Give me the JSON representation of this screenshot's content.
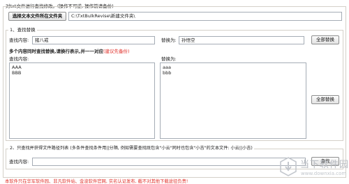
{
  "header": {
    "title": "对txt文件进行查找修改。",
    "note": "(操作不可逆, 操作前请备份)"
  },
  "folder": {
    "button_label": "选择文本文件所在文件夹",
    "path_value": "C:\\TxtBulkRevise\\新建文件夹\\"
  },
  "section1": {
    "legend": "1、查找替换",
    "find_label": "查找内容:",
    "find_value": "猪八戒",
    "replace_label": "替换为:",
    "replace_value": "孙悟空",
    "replace_all_label": "全部替换",
    "multi_title": "多个内容同时查找替换,请换行表示,并一一对应",
    "multi_hint": "(建议先备份)",
    "multi_find_label": "查找内容:",
    "multi_find_lines": "AAA\nBBB",
    "multi_replace_label": "替换为:",
    "multi_replace_lines": "aaa\nbbb",
    "multi_replace_all_label": "全部替换"
  },
  "section2": {
    "legend": "2、只查找并获得文件路径列表 (多条件查找条件用||分隔, 例如需要查找既包含\"小云\"同时也包含\"小吉\"的文本文件: 小云||小吉)",
    "find_label": "查找内容:",
    "find_value": "",
    "find_button_label": "查找"
  },
  "footer": {
    "notice": "本软件只在华军软件园、非凡软件站、金浚软件官网, 实名认证发布, 截不对其他下载途径负责!"
  },
  "watermark": {
    "name": "当下软件园",
    "url": "www.downxia.com",
    "icon": "download-arrow-icon"
  },
  "colors": {
    "accent_red": "#e0302a",
    "border": "#d4d0c8",
    "watermark": "#b8bcc2"
  }
}
